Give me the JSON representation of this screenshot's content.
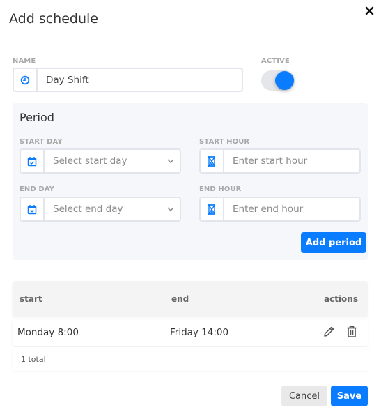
{
  "dialog": {
    "title": "Add schedule",
    "close_icon": "close-icon"
  },
  "name_field": {
    "label": "NAME",
    "value": "Day Shift",
    "icon": "clock-icon"
  },
  "active_toggle": {
    "label": "ACTIVE",
    "on": true
  },
  "period": {
    "title": "Period",
    "start_day": {
      "label": "START DAY",
      "placeholder": "Select start day",
      "icon": "calendar-check-icon"
    },
    "start_hour": {
      "label": "START HOUR",
      "placeholder": "Enter start hour",
      "icon": "hourglass-icon"
    },
    "end_day": {
      "label": "END DAY",
      "placeholder": "Select end day",
      "icon": "calendar-x-icon"
    },
    "end_hour": {
      "label": "END HOUR",
      "placeholder": "Enter end hour",
      "icon": "hourglass-icon"
    },
    "add_button": "Add period"
  },
  "table": {
    "columns": [
      "start",
      "end",
      "actions"
    ],
    "rows": [
      {
        "start": "Monday 8:00",
        "end": "Friday 14:00"
      }
    ],
    "total": "1 total"
  },
  "footer": {
    "cancel": "Cancel",
    "save": "Save"
  },
  "colors": {
    "accent": "#0a7cff",
    "panel_bg": "#f6f7fb",
    "secondary_btn": "#e9e9e9"
  }
}
